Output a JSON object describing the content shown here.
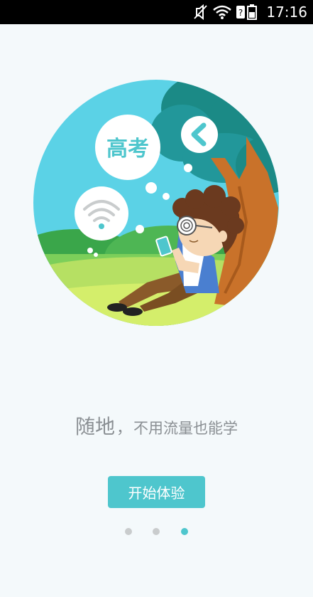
{
  "status_bar": {
    "time": "17:16",
    "icons": [
      "mute-icon",
      "wifi-icon",
      "sim-unknown-icon",
      "battery-icon"
    ]
  },
  "illustration": {
    "bubble_exam_text": "高考",
    "icons": [
      "wifi-icon",
      "back-arrow-icon",
      "phone-icon"
    ]
  },
  "tagline": {
    "emphasis": "随地",
    "separator": "，",
    "rest": "不用流量也能学"
  },
  "start_button": {
    "label": "开始体验"
  },
  "pager": {
    "count": 3,
    "active_index": 2
  },
  "colors": {
    "accent": "#4ec6cd",
    "sky": "#5bd2e6",
    "tree": "#1b8a86",
    "grass": "#cfe95f",
    "text": "#8a8f93"
  }
}
